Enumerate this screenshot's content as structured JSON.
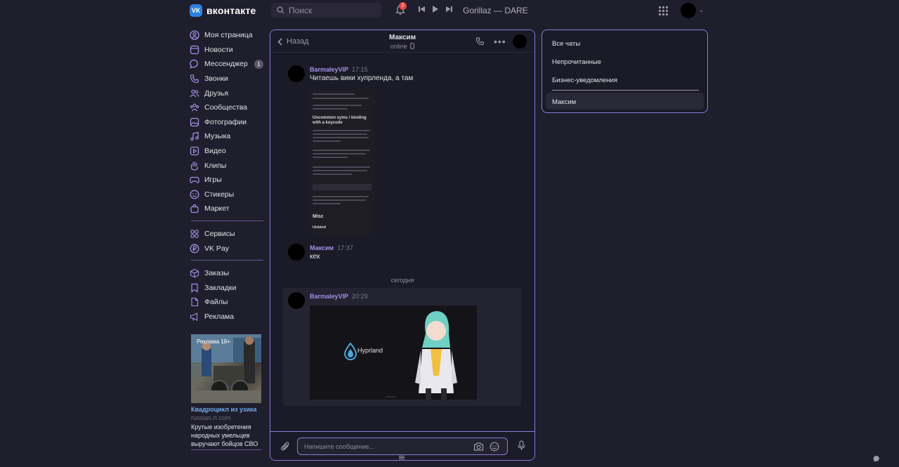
{
  "topbar": {
    "logo_mark": "VK",
    "logo_text": "вконтакте",
    "search_placeholder": "Поиск",
    "notifications_count": "2",
    "now_playing": "Gorillaz — DARE"
  },
  "sidebar": {
    "items": [
      {
        "label": "Моя страница",
        "icon": "user-icon"
      },
      {
        "label": "Новости",
        "icon": "news-icon"
      },
      {
        "label": "Мессенджер",
        "icon": "messenger-icon",
        "badge": "1"
      },
      {
        "label": "Звонки",
        "icon": "phone-icon"
      },
      {
        "label": "Друзья",
        "icon": "friends-icon"
      },
      {
        "label": "Сообщества",
        "icon": "communities-icon"
      },
      {
        "label": "Фотографии",
        "icon": "photos-icon"
      },
      {
        "label": "Музыка",
        "icon": "music-icon"
      },
      {
        "label": "Видео",
        "icon": "video-icon"
      },
      {
        "label": "Клипы",
        "icon": "clips-icon"
      },
      {
        "label": "Игры",
        "icon": "games-icon"
      },
      {
        "label": "Стикеры",
        "icon": "stickers-icon"
      },
      {
        "label": "Маркет",
        "icon": "market-icon"
      }
    ],
    "services": [
      {
        "label": "Сервисы",
        "icon": "services-icon"
      },
      {
        "label": "VK Pay",
        "icon": "vkpay-icon"
      }
    ],
    "extra": [
      {
        "label": "Заказы",
        "icon": "orders-icon"
      },
      {
        "label": "Закладки",
        "icon": "bookmarks-icon"
      },
      {
        "label": "Файлы",
        "icon": "files-icon"
      },
      {
        "label": "Реклама",
        "icon": "ads-icon"
      }
    ]
  },
  "ad": {
    "image_tag": "Реклама 18+",
    "title": "Квадроцикл из узика",
    "domain": "russian.rt.com",
    "description": "Крутые изобретения народных умельцев выручают бойцов СВО"
  },
  "chat": {
    "back_label": "Назад",
    "contact_name": "Максим",
    "contact_status": "online",
    "messages": [
      {
        "author": "BarmaleyVIP",
        "time": "17:15",
        "text": "Читаешь вики хупрленда, а там"
      },
      {
        "author": "Максим",
        "time": "17:37",
        "text": "кек"
      },
      {
        "author": "BarmaleyVIP",
        "time": "20:29",
        "text": ""
      }
    ],
    "screenshot_headings": [
      "Uncommon syms / binding with a keycode",
      "Misc",
      "Unbind"
    ],
    "date_separator": "сегодня",
    "image_caption": "Hyprland",
    "composer_placeholder": "Напишите сообщение..."
  },
  "folders": {
    "items": [
      "Все чаты",
      "Непрочитанные",
      "Бизнес-уведомления"
    ],
    "active": "Максим"
  },
  "colors": {
    "background": "#1f1e2c",
    "accent": "#8a7ce0",
    "author": "#a491e6",
    "link": "#71aaeb"
  }
}
